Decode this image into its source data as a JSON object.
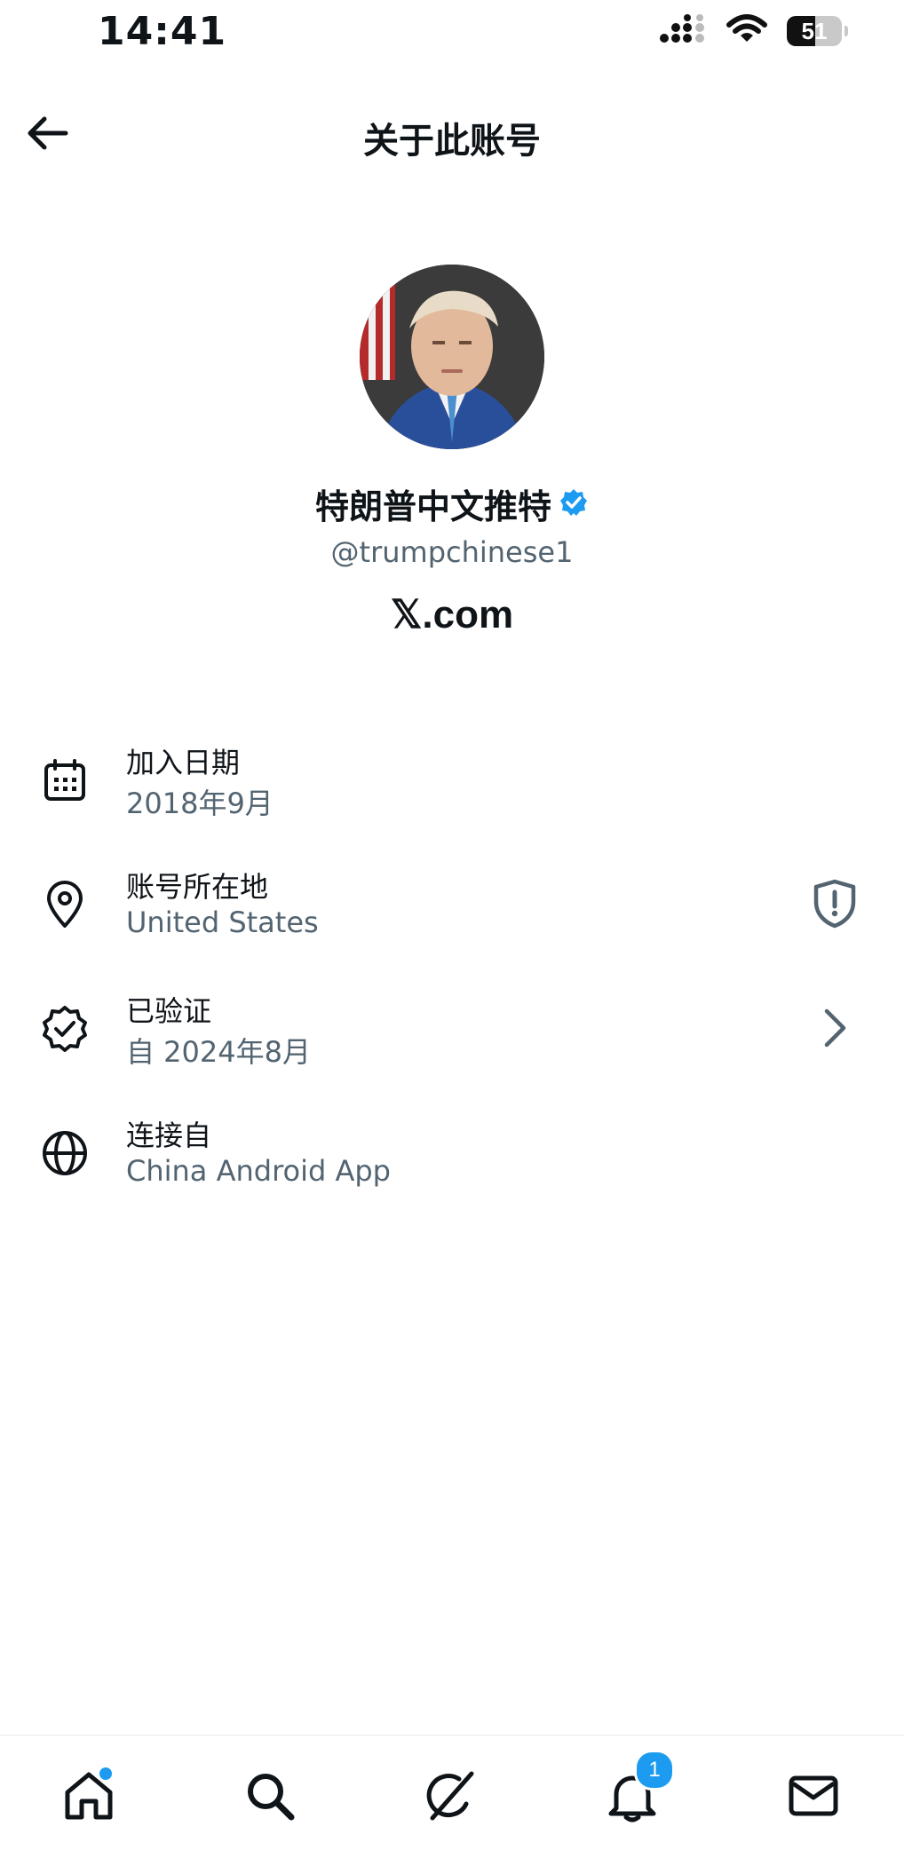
{
  "status_bar": {
    "time": "14:41",
    "battery": "51"
  },
  "header": {
    "title": "关于此账号"
  },
  "profile": {
    "display_name": "特朗普中文推特",
    "handle": "@trumpchinese1",
    "site": "𝕏.com",
    "verified_color": "#1d9bf0"
  },
  "info": [
    {
      "icon": "calendar-icon",
      "label": "加入日期",
      "value": "2018年9月"
    },
    {
      "icon": "location-pin-icon",
      "label": "账号所在地",
      "value": "United States",
      "trailing": "shield-alert-icon"
    },
    {
      "icon": "verified-badge-icon",
      "label": "已验证",
      "value": "自 2024年8月",
      "trailing": "chevron-right-icon"
    },
    {
      "icon": "globe-icon",
      "label": "连接自",
      "value": "China Android App"
    }
  ],
  "nav": {
    "notifications_badge": "1"
  },
  "colors": {
    "accent": "#1d9bf0",
    "secondary_text": "#536471",
    "primary_text": "#0f1419"
  }
}
